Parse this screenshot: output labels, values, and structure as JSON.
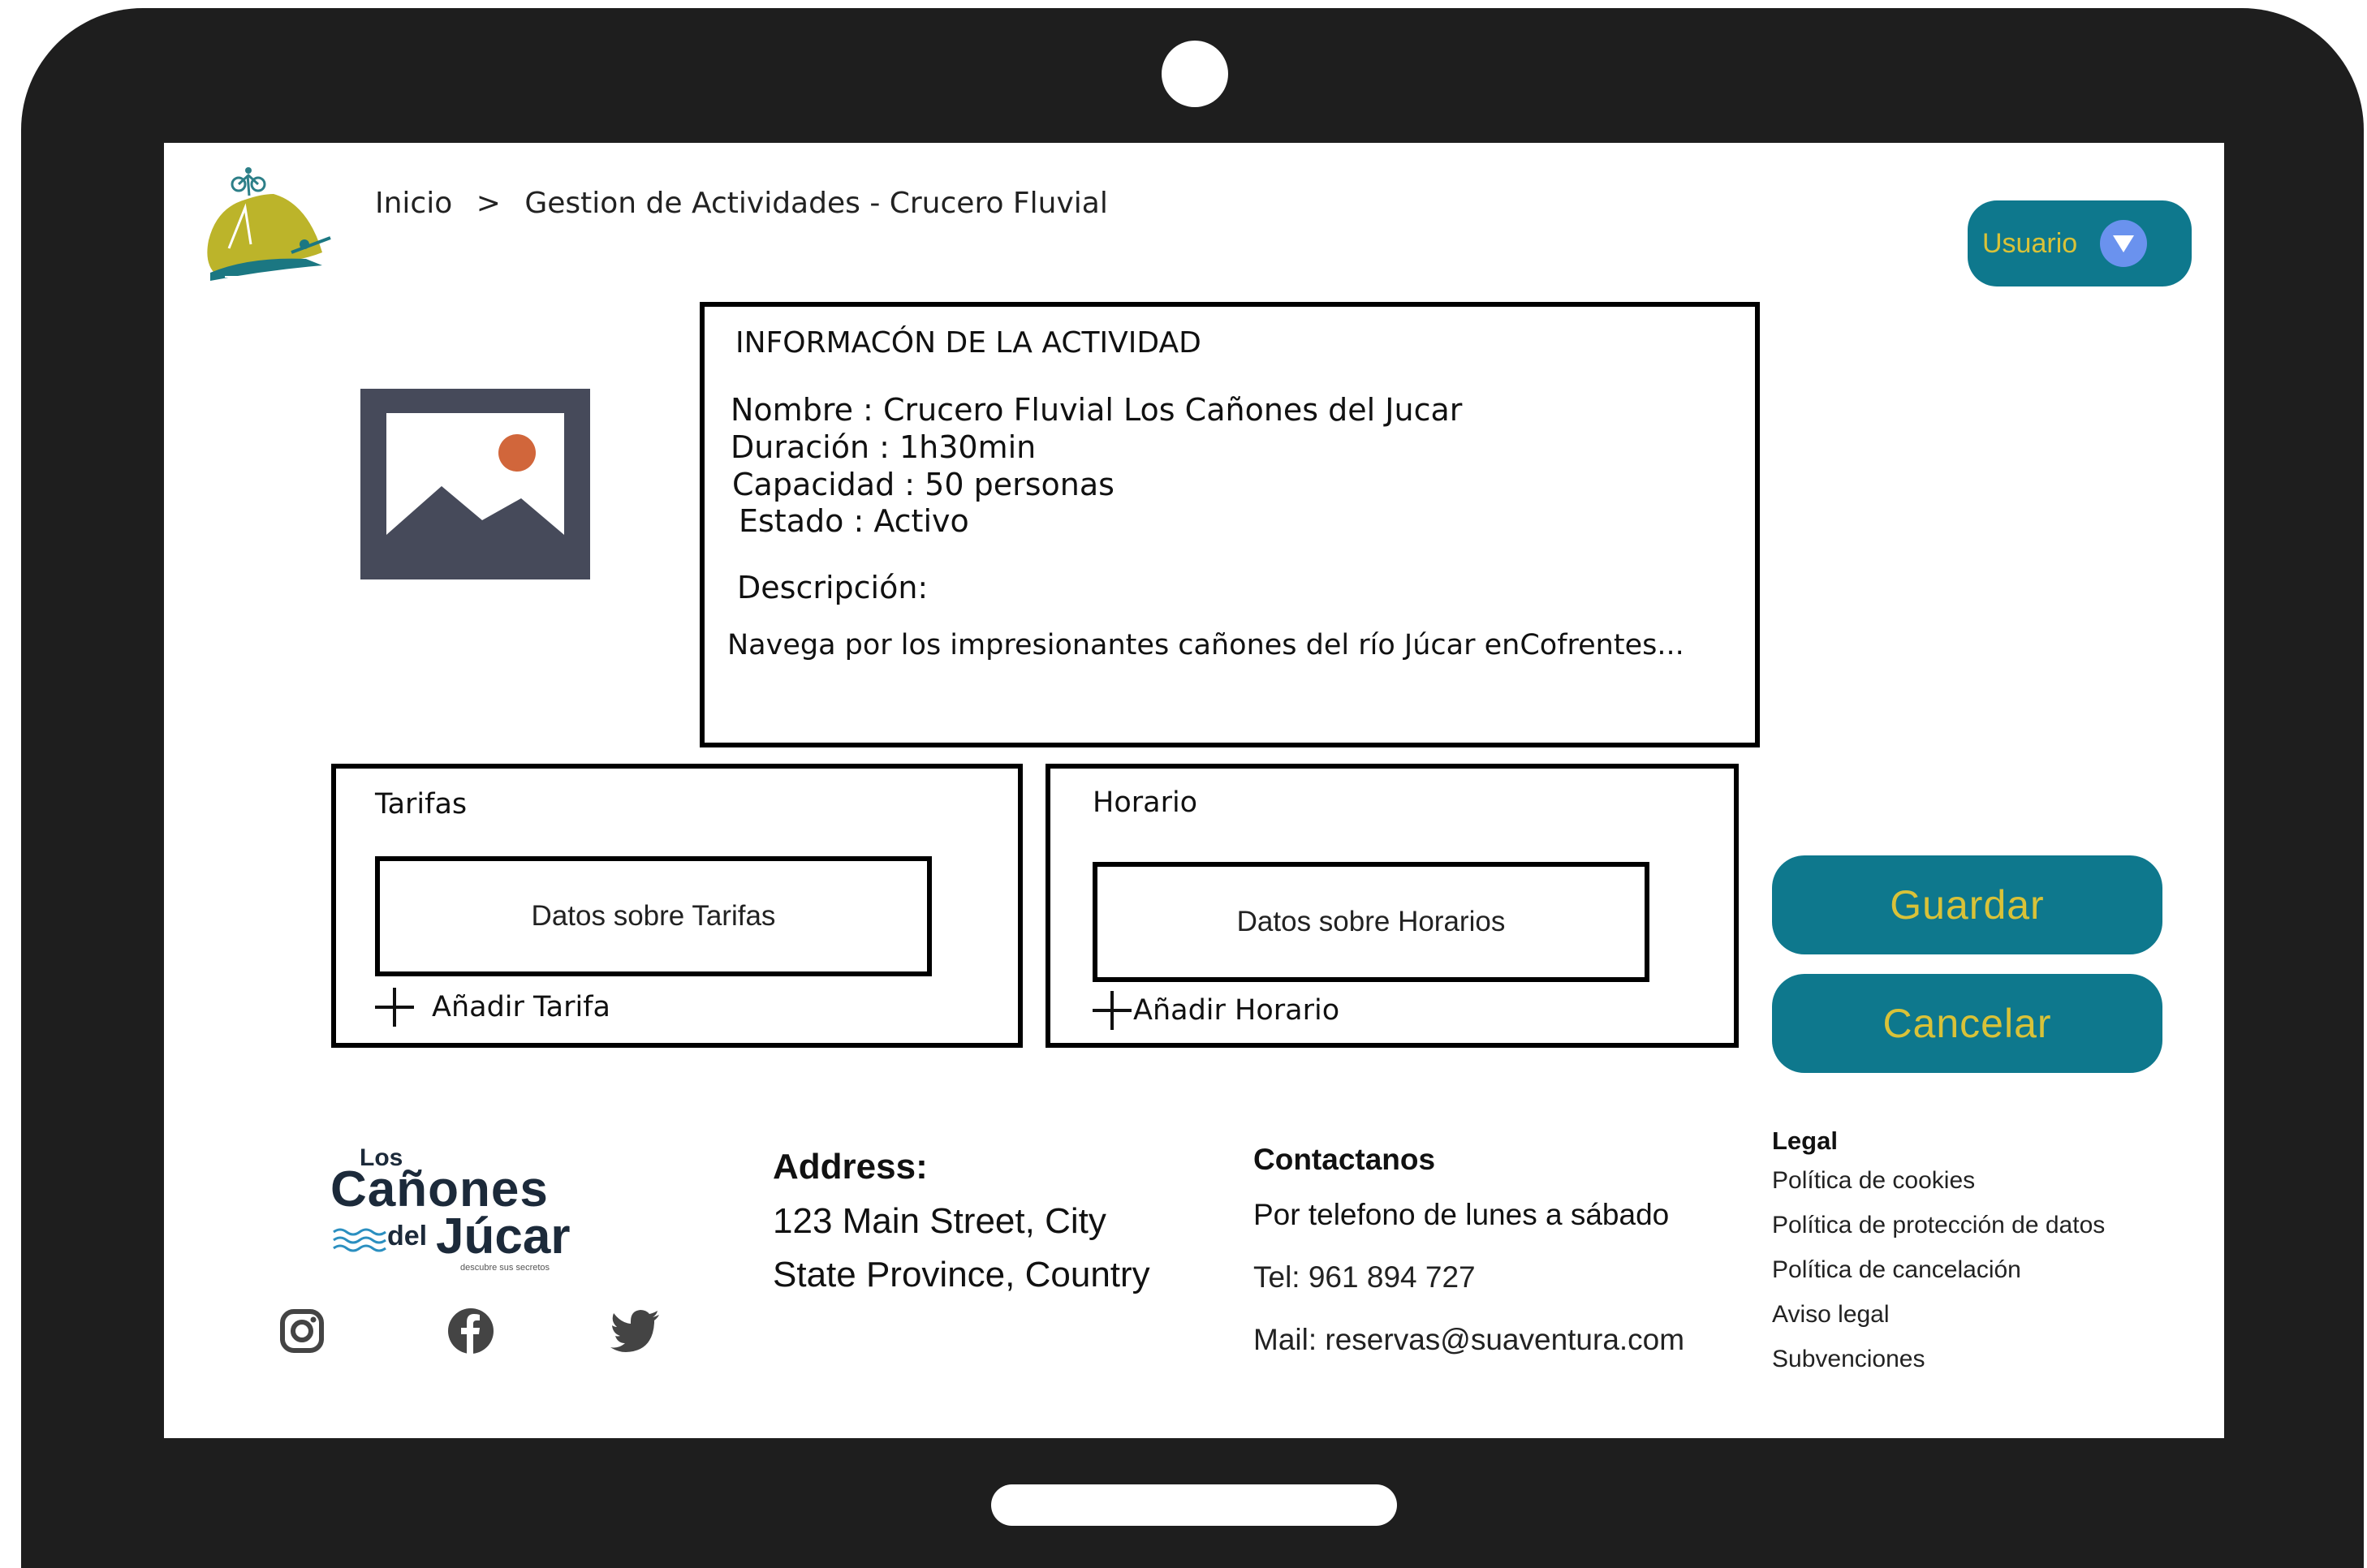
{
  "breadcrumb": {
    "home": "Inicio",
    "separator": ">",
    "current": "Gestion de Actividades - Crucero Fluvial"
  },
  "user_menu": {
    "label": "Usuario",
    "icon": "chevron-down-icon"
  },
  "activity": {
    "section_title": "INFORMACÓN DE LA ACTIVIDAD",
    "name_line": "Nombre : Crucero Fluvial Los Cañones del Jucar",
    "duration_line": "Duración : 1h30min",
    "capacity_line": "Capacidad : 50 personas",
    "status_line": "Estado : Activo",
    "description_label": "Descripción:",
    "description_text": "Navega por los impresionantes cañones del  río Júcar enCofrentes..."
  },
  "tarifas": {
    "title": "Tarifas",
    "data_placeholder": "Datos sobre Tarifas",
    "add_label": "Añadir Tarifa"
  },
  "horario": {
    "title": "Horario",
    "data_placeholder": "Datos sobre Horarios",
    "add_label": "Añadir Horario"
  },
  "actions": {
    "save_label": "Guardar",
    "cancel_label": "Cancelar"
  },
  "footer": {
    "brand": {
      "los": "Los",
      "canones": "Cañones",
      "del": "del",
      "jucar": "Júcar",
      "tagline": "descubre sus secretos"
    },
    "address": {
      "title": "Address:",
      "line1": "123 Main Street, City",
      "line2": "State Province, Country"
    },
    "contact": {
      "title": "Contactanos",
      "line1": "Por telefono de lunes a sábado",
      "phone": "Tel: 961 894 727",
      "mail": "Mail: reservas@suaventura.com"
    },
    "legal": {
      "title": "Legal",
      "links": [
        "Política de cookies",
        "Política de protección de datos",
        "Política de cancelación",
        "Aviso legal",
        "Subvenciones"
      ]
    },
    "social": [
      "instagram-icon",
      "facebook-icon",
      "twitter-icon"
    ]
  },
  "colors": {
    "device_frame": "#1e1e1e",
    "accent_teal": "#0e788d",
    "button_text_yellow": "#d9c238",
    "dropdown_circle": "#6a92ee",
    "placeholder_image": "#464a5a",
    "placeholder_sun": "#d1663b",
    "logo_olive": "#bcb42a"
  }
}
